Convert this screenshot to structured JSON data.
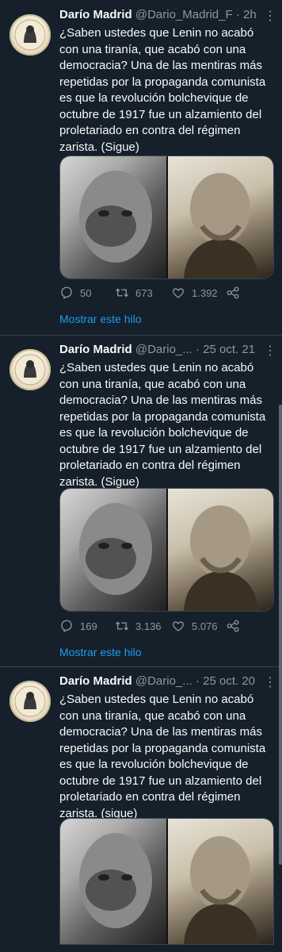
{
  "tweets": [
    {
      "author": "Darío Madrid",
      "handle": "@Dario_Madrid_F",
      "separator": "·",
      "time": "2h",
      "text": "¿Saben ustedes que Lenin no acabó con una tiranía, que acabó con una democracia? Una de las mentiras más repetidas por la propaganda comunista es que la revolución bolchevique de octubre de 1917 fue un alzamiento del proletariado en contra del régimen zarista.",
      "suffix": " (Sigue)",
      "replies": "50",
      "retweets": "673",
      "likes": "1.392",
      "show_thread": "Mostrar este hilo"
    },
    {
      "author": "Darío Madrid",
      "handle": "@Dario_...",
      "separator": "·",
      "time": "25 oct. 21",
      "text": "¿Saben ustedes que Lenin no acabó con una tiranía, que acabó con una democracia? Una de las mentiras más repetidas por la propaganda comunista es que la revolución bolchevique de octubre de 1917 fue un alzamiento del proletariado en contra del régimen zarista.",
      "suffix": " (Sigue)",
      "replies": "169",
      "retweets": "3.136",
      "likes": "5.076",
      "show_thread": "Mostrar este hilo"
    },
    {
      "author": "Darío Madrid",
      "handle": "@Dario_...",
      "separator": "·",
      "time": "25 oct. 20",
      "text": "¿Saben ustedes que Lenin no acabó con una tiranía, que acabó con una democracia? Una de las mentiras más repetidas por la propaganda comunista es que la revolución bolchevique de octubre de 1917 fue un alzamiento del proletariado en contra del régimen zarista.",
      "suffix": " (sigue)"
    }
  ],
  "icons": {
    "more": "more-icon",
    "reply": "reply-icon",
    "retweet": "retweet-icon",
    "like": "like-icon",
    "share": "share-icon"
  },
  "colors": {
    "background": "#15202b",
    "text": "#f7f9f9",
    "secondary": "#8b98a5",
    "link": "#1d9bf0",
    "divider": "#38444d"
  }
}
